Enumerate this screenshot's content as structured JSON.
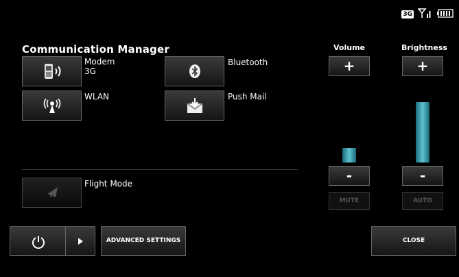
{
  "status": {
    "network": "3G",
    "signal_icon": "signal-bars-icon",
    "battery_icon": "battery-icon"
  },
  "title": "Communication Manager",
  "tiles": [
    {
      "line1": "Modem",
      "line2": "3G",
      "icon": "phone-wireless-icon"
    },
    {
      "line1": "Bluetooth",
      "icon": "bluetooth-icon"
    },
    {
      "line1": "WLAN",
      "icon": "wlan-antenna-icon"
    },
    {
      "line1": "Push Mail",
      "icon": "push-mail-icon"
    }
  ],
  "flight": {
    "label": "Flight Mode",
    "icon": "airplane-icon"
  },
  "volume": {
    "label": "Volume",
    "plus": "+",
    "minus": "-",
    "mute": "MUTE",
    "level": 0.21
  },
  "brightness": {
    "label": "Brightness",
    "plus": "+",
    "minus": "-",
    "auto": "AUTO",
    "level": 0.88
  },
  "bottom": {
    "advanced": "ADVANCED SETTINGS",
    "close": "CLOSE",
    "power_icon": "power-icon",
    "arrow_icon": "play-arrow-icon"
  }
}
